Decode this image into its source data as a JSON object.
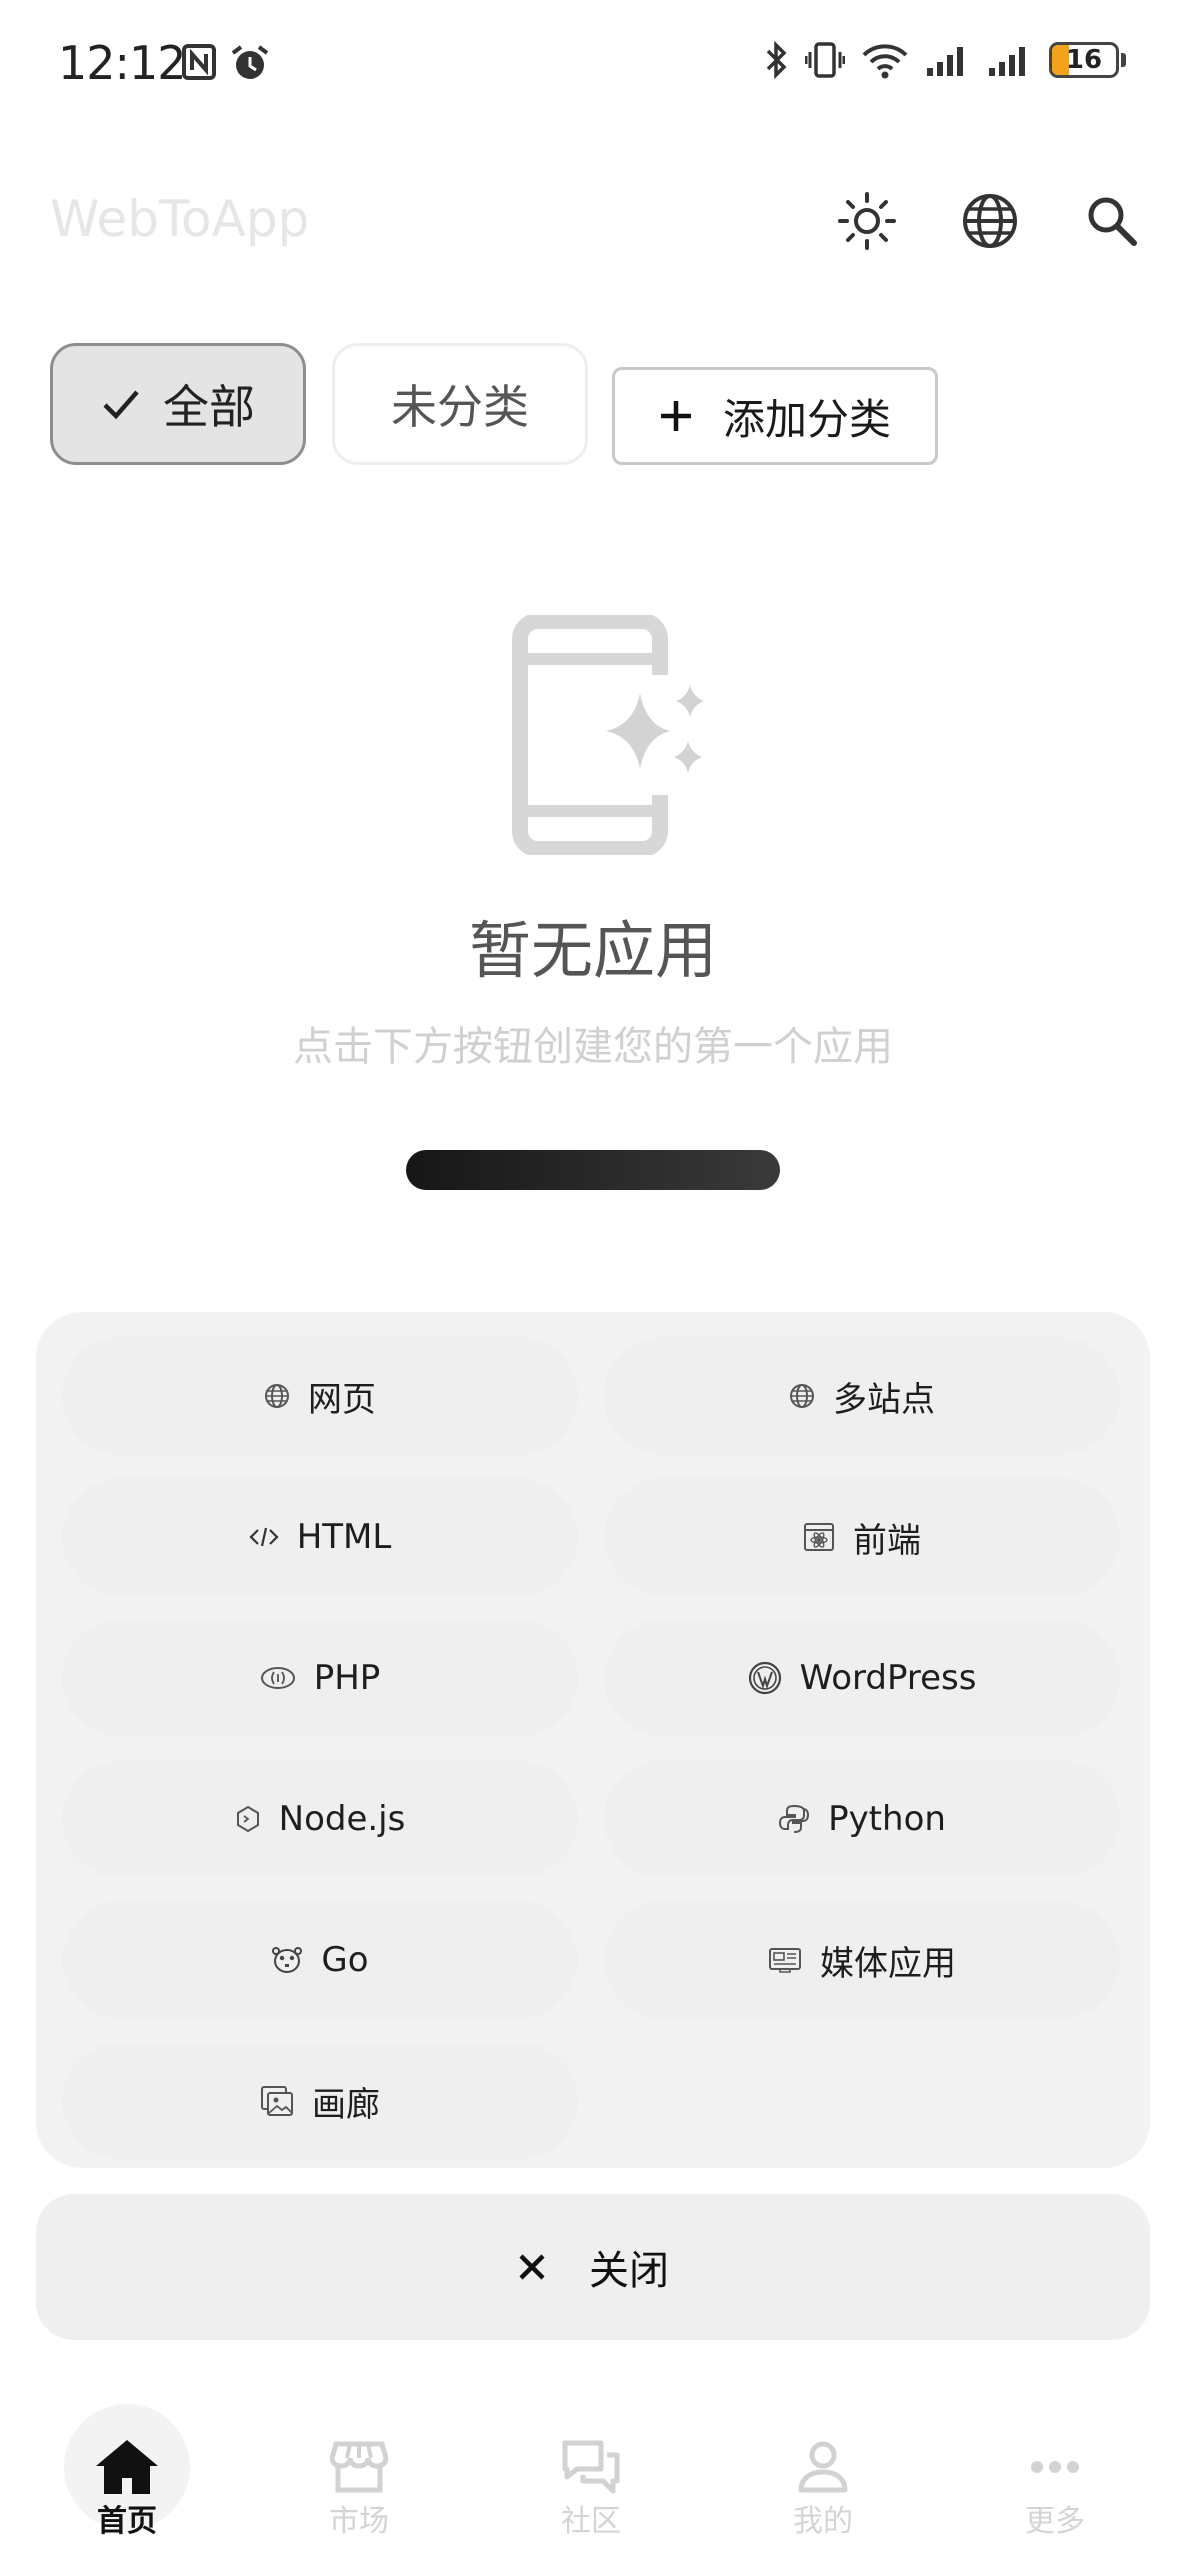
{
  "status_bar": {
    "time": "12:12",
    "battery_level": "16",
    "icons": [
      "nfc-icon",
      "alarm-icon",
      "bluetooth-icon",
      "vibrate-icon",
      "wifi-icon",
      "signal-icon",
      "signal-icon",
      "battery-icon"
    ]
  },
  "app_bar": {
    "title": "WebToApp",
    "actions": [
      "theme-sun-icon",
      "language-globe-icon",
      "search-icon"
    ]
  },
  "categories": {
    "all_label": "全部",
    "uncategorized_label": "未分类",
    "add_label": "添加分类",
    "selected": "全部"
  },
  "empty_state": {
    "title": "暂无应用",
    "subtitle": "点击下方按钮创建您的第一个应用"
  },
  "app_types": [
    {
      "label": "网页",
      "icon": "globe-icon"
    },
    {
      "label": "多站点",
      "icon": "globe-icon"
    },
    {
      "label": "HTML",
      "icon": "code-icon"
    },
    {
      "label": "前端",
      "icon": "react-icon"
    },
    {
      "label": "PHP",
      "icon": "php-icon"
    },
    {
      "label": "WordPress",
      "icon": "wordpress-icon"
    },
    {
      "label": "Node.js",
      "icon": "nodejs-icon"
    },
    {
      "label": "Python",
      "icon": "python-icon"
    },
    {
      "label": "Go",
      "icon": "gopher-icon"
    },
    {
      "label": "媒体应用",
      "icon": "media-icon"
    },
    {
      "label": "画廊",
      "icon": "gallery-icon"
    }
  ],
  "close_label": "关闭",
  "bottom_nav": [
    {
      "label": "首页",
      "icon": "home-icon",
      "active": true
    },
    {
      "label": "市场",
      "icon": "store-icon",
      "active": false
    },
    {
      "label": "社区",
      "icon": "chat-icon",
      "active": false
    },
    {
      "label": "我的",
      "icon": "person-icon",
      "active": false
    },
    {
      "label": "更多",
      "icon": "more-icon",
      "active": false
    }
  ],
  "colors": {
    "accent_dark": "#1a1a1a",
    "sheet_bg": "#f2f2f2",
    "battery_fill": "#f4a11d",
    "inactive_text": "#d4d4d4"
  }
}
